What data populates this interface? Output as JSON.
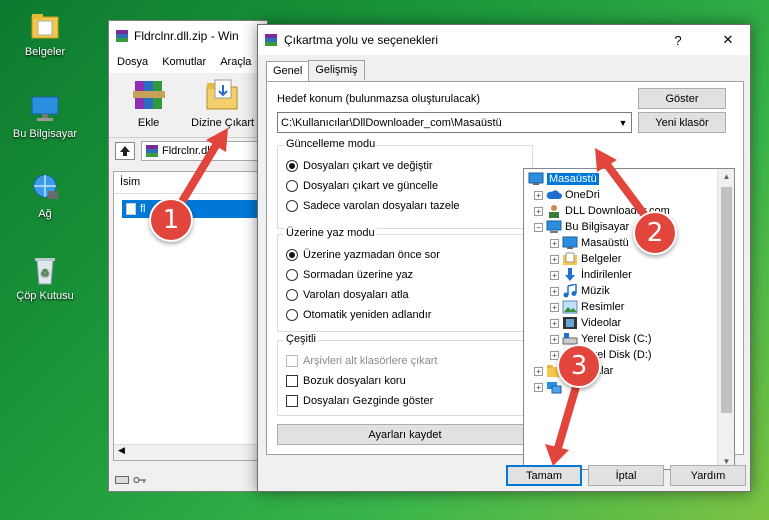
{
  "desktop": {
    "icons": [
      {
        "label": "Belgeler"
      },
      {
        "label": "Bu Bilgisayar"
      },
      {
        "label": "Ağ"
      },
      {
        "label": "Çöp Kutusu"
      }
    ]
  },
  "winrar": {
    "title": "Fldrclnr.dll.zip - Win",
    "menu": [
      "Dosya",
      "Komutlar",
      "Araçla"
    ],
    "toolbar": {
      "add": "Ekle",
      "extract_to": "Dizine Çıkart"
    },
    "path": "Fldrclnr.dll.",
    "column_name": "İsim",
    "file_row": "fl     dll",
    "icons": {
      "up": "up-arrow-icon"
    }
  },
  "dialog": {
    "title": "Çıkartma yolu ve seçenekleri",
    "help": "?",
    "close": "✕",
    "tabs": [
      "Genel",
      "Gelişmiş"
    ],
    "target_label": "Hedef konum (bulunmazsa oluşturulacak)",
    "target_value": "C:\\Kullanıcılar\\DllDownloader_com\\Masaüstü",
    "show_button": "Göster",
    "new_folder_button": "Yeni klasör",
    "update_mode": {
      "title": "Güncelleme modu",
      "options": [
        "Dosyaları çıkart ve değiştir",
        "Dosyaları çıkart ve güncelle",
        "Sadece varolan dosyaları tazele"
      ],
      "selected": 0
    },
    "overwrite_mode": {
      "title": "Üzerine yaz modu",
      "options": [
        "Üzerine yazmadan önce sor",
        "Sormadan üzerine yaz",
        "Varolan dosyaları atla",
        "Otomatik yeniden adlandır"
      ],
      "selected": 0
    },
    "misc": {
      "title": "Çeşitli",
      "options": [
        "Arşivleri alt klasörlere çıkart",
        "Bozuk dosyaları koru",
        "Dosyaları Gezginde göster"
      ]
    },
    "save_settings": "Ayarları kaydet",
    "tree": [
      {
        "label": "Masaüstü",
        "level": 0,
        "selected": true,
        "icon": "desktop-icon"
      },
      {
        "label": "OneDri",
        "level": 1,
        "icon": "cloud-icon"
      },
      {
        "label": "DLL Downloader.com",
        "level": 1,
        "icon": "user-icon"
      },
      {
        "label": "Bu Bilgisayar",
        "level": 1,
        "icon": "computer-icon"
      },
      {
        "label": "Masaüstü",
        "level": 2,
        "icon": "desktop-icon"
      },
      {
        "label": "Belgeler",
        "level": 2,
        "icon": "documents-icon"
      },
      {
        "label": "İndirilenler",
        "level": 2,
        "icon": "download-icon"
      },
      {
        "label": "Müzik",
        "level": 2,
        "icon": "music-icon"
      },
      {
        "label": "Resimler",
        "level": 2,
        "icon": "pictures-icon"
      },
      {
        "label": "Videolar",
        "level": 2,
        "icon": "video-icon"
      },
      {
        "label": "Yerel Disk (C:)",
        "level": 2,
        "icon": "drive-icon"
      },
      {
        "label": "Yerel Disk (D:)",
        "level": 2,
        "icon": "drive-icon"
      },
      {
        "label": "Kitaplıklar",
        "level": 1,
        "icon": "library-icon"
      },
      {
        "label": "",
        "level": 1,
        "icon": "network-icon"
      }
    ],
    "ok": "Tamam",
    "cancel": "İptal",
    "help_button": "Yardım"
  },
  "annotations": [
    "1",
    "2",
    "3"
  ],
  "colors": {
    "accent": "#0078d7",
    "annotation": "#e2453c"
  }
}
